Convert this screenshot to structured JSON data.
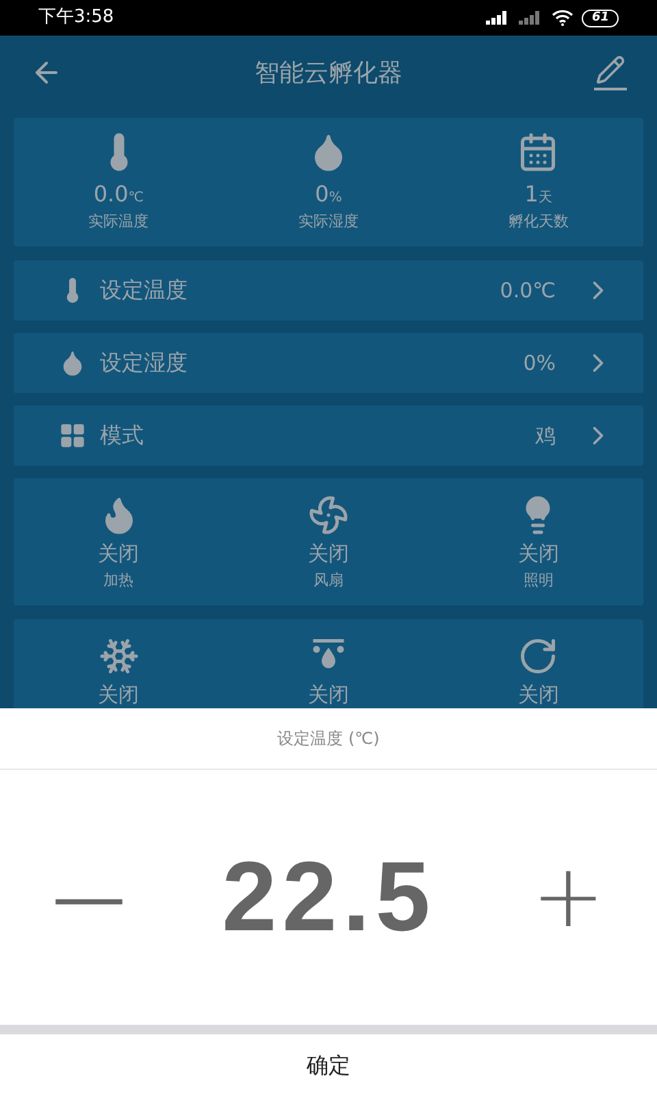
{
  "status_bar": {
    "time": "下午3:58",
    "battery": "61"
  },
  "header": {
    "title": "智能云孵化器"
  },
  "stats": [
    {
      "kind": "temperature",
      "value": "0.0",
      "unit": "℃",
      "label": "实际温度"
    },
    {
      "kind": "humidity",
      "value": "0",
      "unit": "%",
      "label": "实际湿度"
    },
    {
      "kind": "calendar",
      "value": "1",
      "unit": "天",
      "label": "孵化天数"
    }
  ],
  "settings": [
    {
      "kind": "temperature",
      "label": "设定温度",
      "value": "0.0℃"
    },
    {
      "kind": "humidity",
      "label": "设定湿度",
      "value": "0%"
    },
    {
      "kind": "grid",
      "label": "模式",
      "value": "鸡"
    }
  ],
  "devices": [
    {
      "kind": "flame",
      "status": "关闭",
      "label": "加热"
    },
    {
      "kind": "fan",
      "status": "关闭",
      "label": "风扇"
    },
    {
      "kind": "bulb",
      "status": "关闭",
      "label": "照明"
    },
    {
      "kind": "snowflake",
      "status": "关闭"
    },
    {
      "kind": "spray",
      "status": "关闭"
    },
    {
      "kind": "rotate",
      "status": "关闭"
    }
  ],
  "sheet": {
    "title": "设定温度 (℃)",
    "minus": "—",
    "value": "22.5",
    "plus": "+",
    "confirm": "确定"
  }
}
